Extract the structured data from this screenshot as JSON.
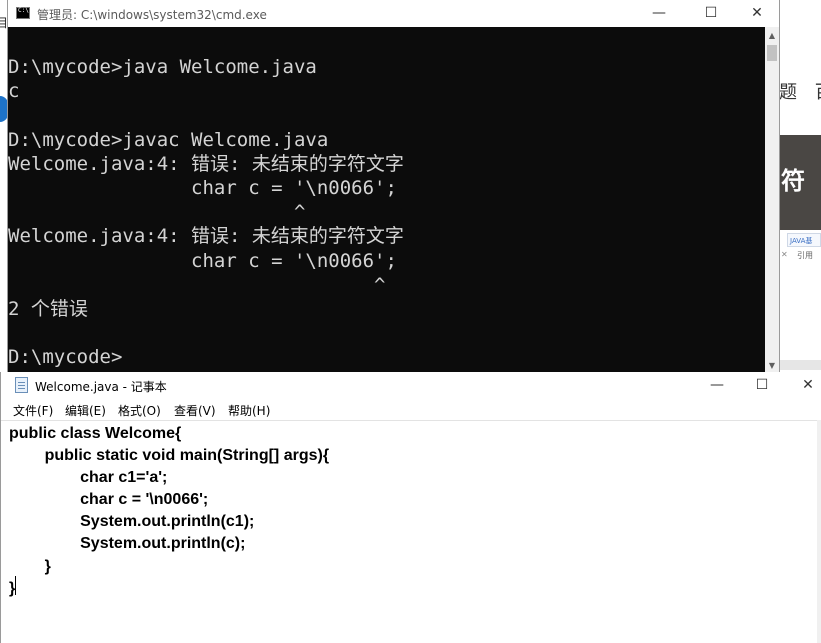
{
  "cmd": {
    "title": "管理员: C:\\windows\\system32\\cmd.exe",
    "controls": {
      "minimize": "—",
      "maximize": "☐",
      "close": "✕"
    },
    "output": [
      "D:\\mycode>java Welcome.java",
      "c",
      "",
      "D:\\mycode>javac Welcome.java",
      "Welcome.java:4: 错误: 未结束的字符文字",
      "                char c = '\\n0066';",
      "                         ^",
      "Welcome.java:4: 错误: 未结束的字符文字",
      "                char c = '\\n0066';",
      "                                ^",
      "2 个错误",
      "",
      "D:\\mycode>"
    ]
  },
  "notepad": {
    "title": "Welcome.java - 记事本",
    "controls": {
      "minimize": "—",
      "maximize": "☐",
      "close": "✕"
    },
    "menu": [
      "文件(F)",
      "编辑(E)",
      "格式(O)",
      "查看(V)",
      "帮助(H)"
    ],
    "code": "public class Welcome{\n\tpublic static void main(String[] args){\n\t\tchar c1='a';\n\t\tchar c = '\\n0066';\n\t\tSystem.out.println(c1);\n\t\tSystem.out.println(c);\n\t}\n}"
  },
  "background": {
    "left_edge_char": "目",
    "right_text": "题 百",
    "banner_text": "符",
    "chip_text": "JAVA基",
    "cite_text": "引用"
  }
}
